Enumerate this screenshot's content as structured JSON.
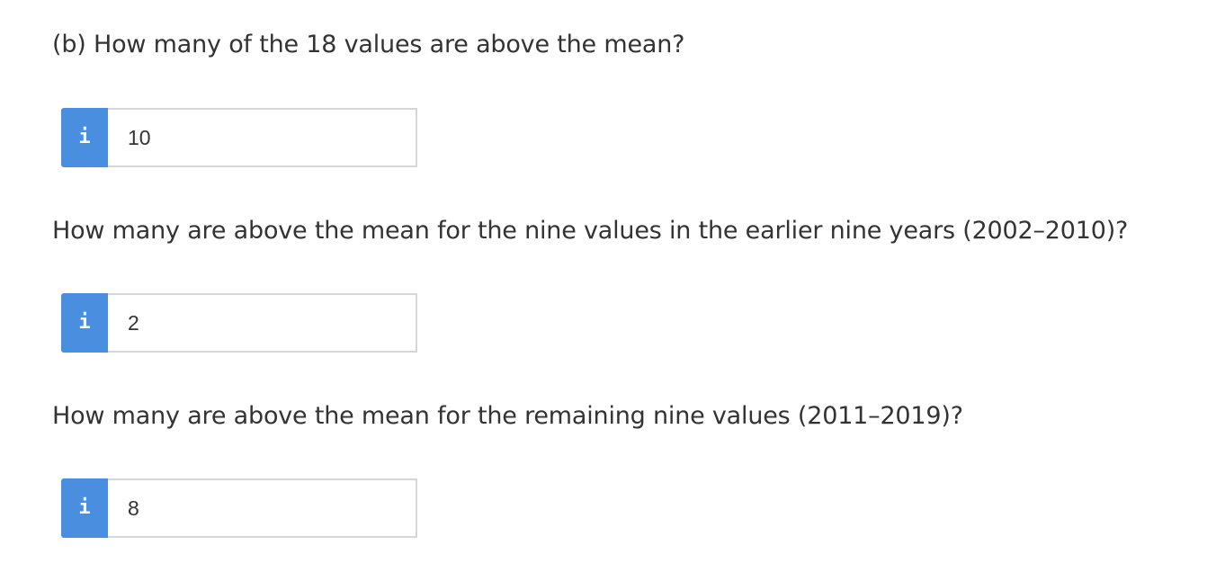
{
  "questions": [
    {
      "text": "(b) How many of the 18 values are above the mean?",
      "info_icon": "i",
      "answer": "10"
    },
    {
      "text": "How many are above the mean for the nine values in the earlier nine years (2002–2010)?",
      "info_icon": "i",
      "answer": "2"
    },
    {
      "text": "How many are above the mean for the remaining nine values (2011–2019)?",
      "info_icon": "i",
      "answer": "8"
    }
  ]
}
